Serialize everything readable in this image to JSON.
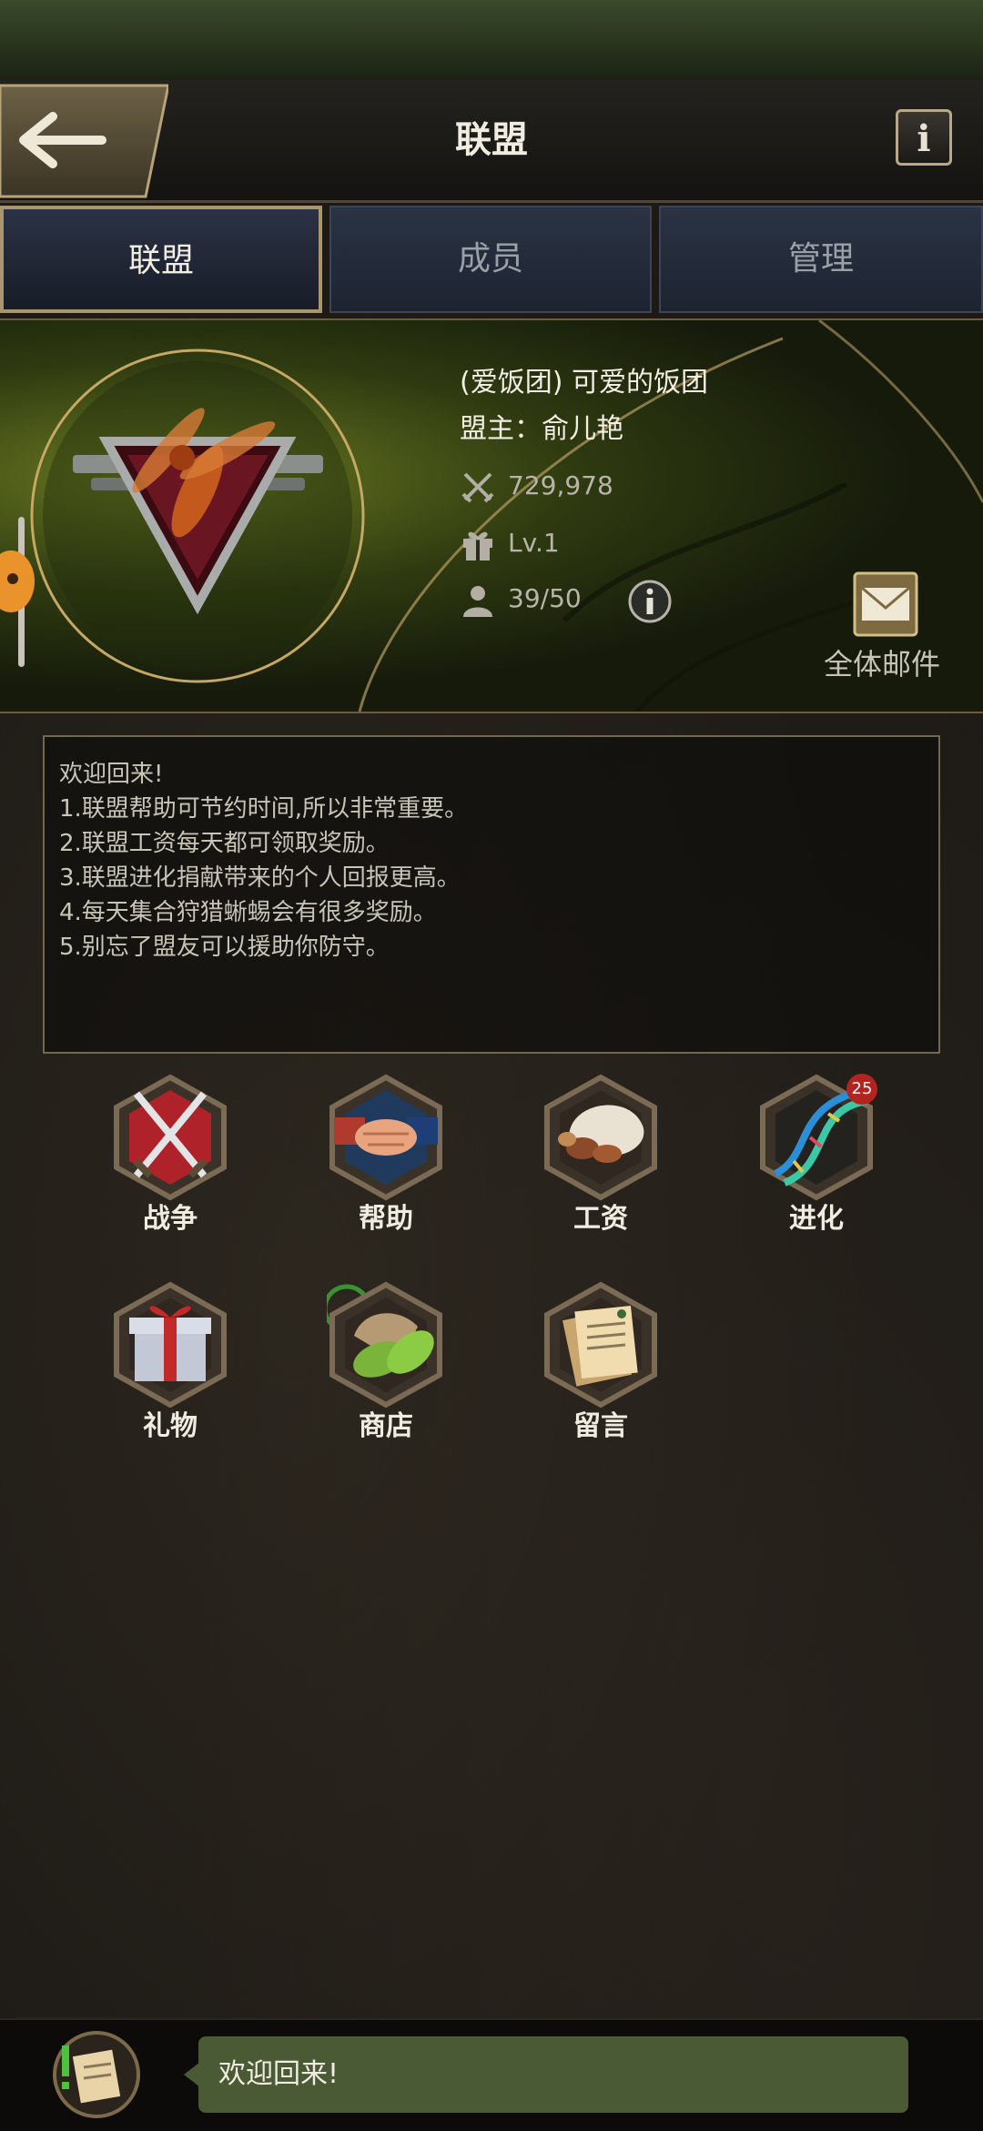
{
  "header": {
    "title": "联盟",
    "info_label": "i"
  },
  "tabs": [
    {
      "label": "联盟",
      "active": true
    },
    {
      "label": "成员",
      "active": false
    },
    {
      "label": "管理",
      "active": false
    }
  ],
  "alliance": {
    "name": "(爱饭团) 可爱的饭团",
    "leader": "盟主：俞儿艳",
    "power": "729,978",
    "level": "Lv.1",
    "members": "39/50",
    "mail_label": "全体邮件"
  },
  "notice": {
    "lines": [
      "欢迎回来!",
      "1.联盟帮助可节约时间,所以非常重要。",
      "2.联盟工资每天都可领取奖励。",
      "3.联盟进化捐献带来的个人回报更高。",
      "4.每天集合狩猎蜥蜴会有很多奖励。",
      "5.别忘了盟友可以援助你防守。"
    ]
  },
  "features": [
    {
      "label": "战争",
      "icon": "crossed-swords-icon"
    },
    {
      "label": "帮助",
      "icon": "handshake-icon"
    },
    {
      "label": "工资",
      "icon": "food-rations-icon"
    },
    {
      "label": "进化",
      "icon": "dna-icon",
      "badge": "25"
    },
    {
      "label": "礼物",
      "icon": "gift-box-icon"
    },
    {
      "label": "商店",
      "icon": "leaf-shop-icon"
    },
    {
      "label": "留言",
      "icon": "notes-icon"
    }
  ],
  "chat": {
    "message": "欢迎回来!"
  },
  "colors": {
    "accent_gold": "#b8a98a",
    "tab_blue": "#2a3344",
    "chat_green": "#4a5a34",
    "badge_red": "#b5231f"
  }
}
